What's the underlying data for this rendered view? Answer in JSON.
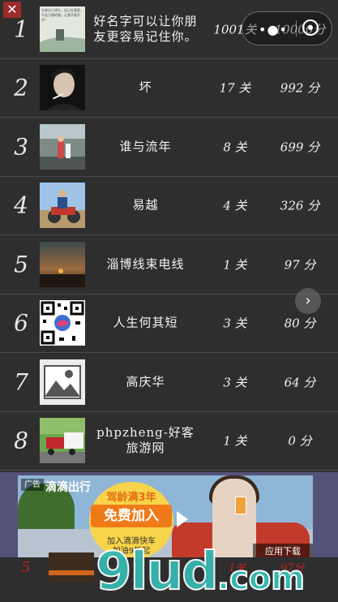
{
  "top_controls": {
    "close_label": "✕",
    "capsule_dots": "•●•"
  },
  "rows": [
    {
      "rank": "1",
      "name": "好名字可以让你朋友更容易记住你。",
      "levels": "1001关",
      "score": "10000分",
      "avatar": "text-quote-thumbnail",
      "avatar_text": "大部分已鸿大，自己在柔里，千丝万缕的路，让我不放不开！"
    },
    {
      "rank": "2",
      "name": "坏",
      "levels": "17 关",
      "score": "992 分",
      "avatar": "man-portrait"
    },
    {
      "rank": "3",
      "name": "谁与流年",
      "levels": "8 关",
      "score": "699 分",
      "avatar": "kids-street-photo"
    },
    {
      "rank": "4",
      "name": "易越",
      "levels": "4 关",
      "score": "326 分",
      "avatar": "family-motorbike-photo"
    },
    {
      "rank": "5",
      "name": "淄博线束电线",
      "levels": "1 关",
      "score": "97 分",
      "avatar": "sunset-photo"
    },
    {
      "rank": "6",
      "name": "人生何其短",
      "levels": "3 关",
      "score": "80 分",
      "avatar": "qr-code"
    },
    {
      "rank": "7",
      "name": "高庆华",
      "levels": "3 关",
      "score": "64 分",
      "avatar": "default-image-placeholder"
    },
    {
      "rank": "8",
      "name": "phpzheng-好客旅游网",
      "levels": "1 关",
      "score": "0 分",
      "avatar": "truck-photo"
    }
  ],
  "ad": {
    "tag": "广告",
    "brand": "滴滴出行",
    "condition": "驾龄满3年",
    "cta": "免费加入",
    "line1": "加入滴滴快车",
    "line2": "加油9折起",
    "download": "应用下载"
  },
  "partial_row": {
    "rank": "5",
    "levels": "1关",
    "score": "97分"
  },
  "watermark": {
    "main": "9lud",
    "suffix": ".com"
  },
  "colors": {
    "background": "#2e2e2e",
    "divider": "#4a4a4a",
    "close_button": "#9c2b2b",
    "ad_button": "#f07a18",
    "watermark": "#35b8b0"
  }
}
